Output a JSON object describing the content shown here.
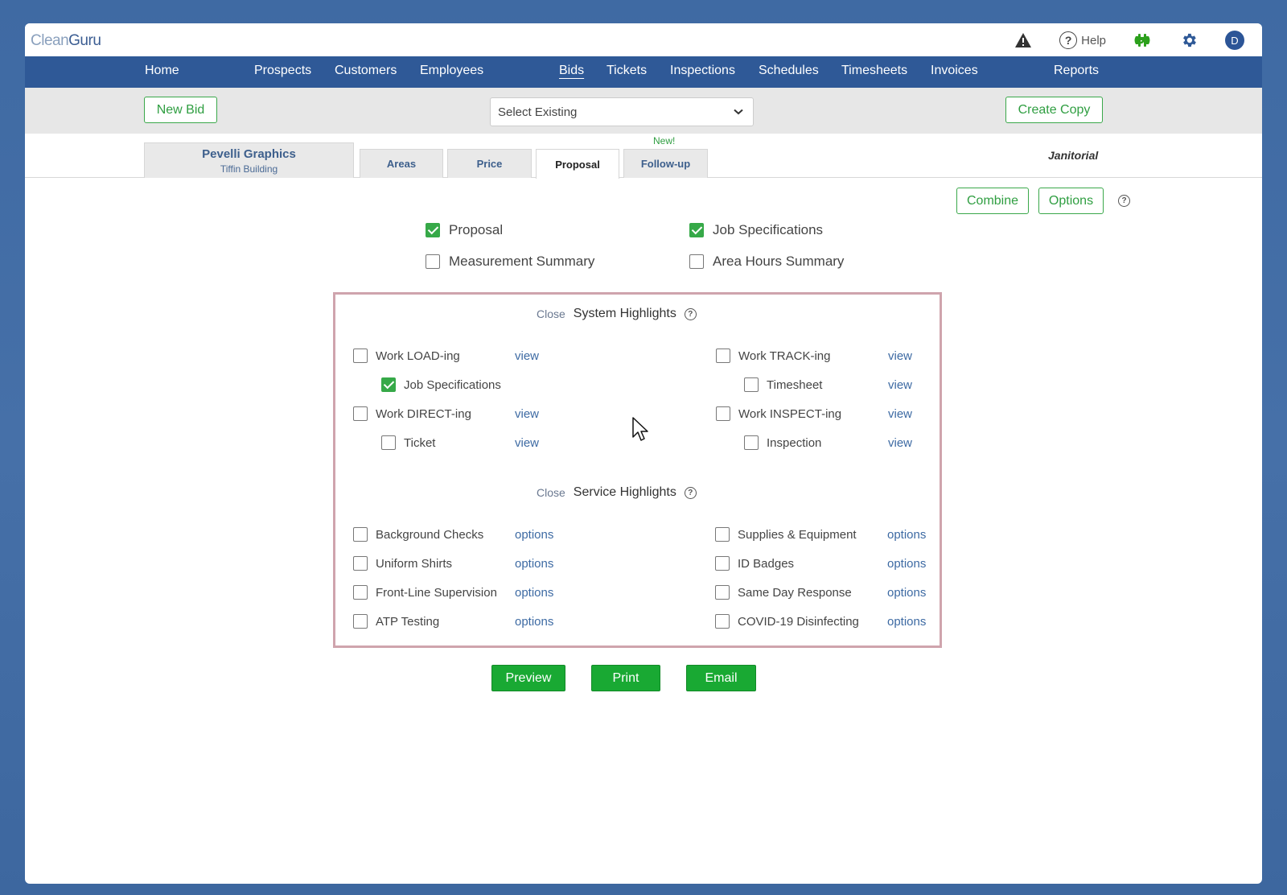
{
  "app": {
    "logo_prefix": "Clean",
    "logo_suffix": "Guru"
  },
  "topbar": {
    "help_label": "Help",
    "avatar_initial": "D"
  },
  "nav": {
    "items": [
      "Home",
      "Prospects",
      "Customers",
      "Employees",
      "Bids",
      "Tickets",
      "Inspections",
      "Schedules",
      "Timesheets",
      "Invoices",
      "Reports"
    ],
    "active": "Bids"
  },
  "toolbar": {
    "new_bid": "New Bid",
    "select_existing": "Select Existing",
    "create_copy": "Create Copy"
  },
  "client": {
    "name": "Pevelli Graphics",
    "building": "Tiffin Building"
  },
  "tabs": {
    "areas": "Areas",
    "price": "Price",
    "proposal": "Proposal",
    "followup": "Follow-up",
    "new_badge": "New!"
  },
  "category": "Janitorial",
  "actions": {
    "combine": "Combine",
    "options": "Options"
  },
  "documents": {
    "proposal": "Proposal",
    "job_specifications": "Job Specifications",
    "measurement_summary": "Measurement Summary",
    "area_hours_summary": "Area Hours Summary"
  },
  "system_highlights": {
    "close": "Close",
    "title": "System Highlights",
    "work_loading": "Work LOAD-ing",
    "job_specifications": "Job Specifications",
    "work_directing": "Work DIRECT-ing",
    "ticket": "Ticket",
    "work_tracking": "Work TRACK-ing",
    "timesheet": "Timesheet",
    "work_inspecting": "Work INSPECT-ing",
    "inspection": "Inspection",
    "view": "view"
  },
  "service_highlights": {
    "close": "Close",
    "title": "Service Highlights",
    "background_checks": "Background Checks",
    "uniform_shirts": "Uniform Shirts",
    "front_line_supervision": "Front-Line Supervision",
    "atp_testing": "ATP Testing",
    "supplies_equipment": "Supplies & Equipment",
    "id_badges": "ID Badges",
    "same_day_response": "Same Day Response",
    "covid_disinfecting": "COVID-19 Disinfecting",
    "options": "options"
  },
  "bottom": {
    "preview": "Preview",
    "print": "Print",
    "email": "Email"
  },
  "colors": {
    "nav": "#2f5997",
    "accent_green": "#19a933",
    "panel_border": "#cfa4ad"
  }
}
